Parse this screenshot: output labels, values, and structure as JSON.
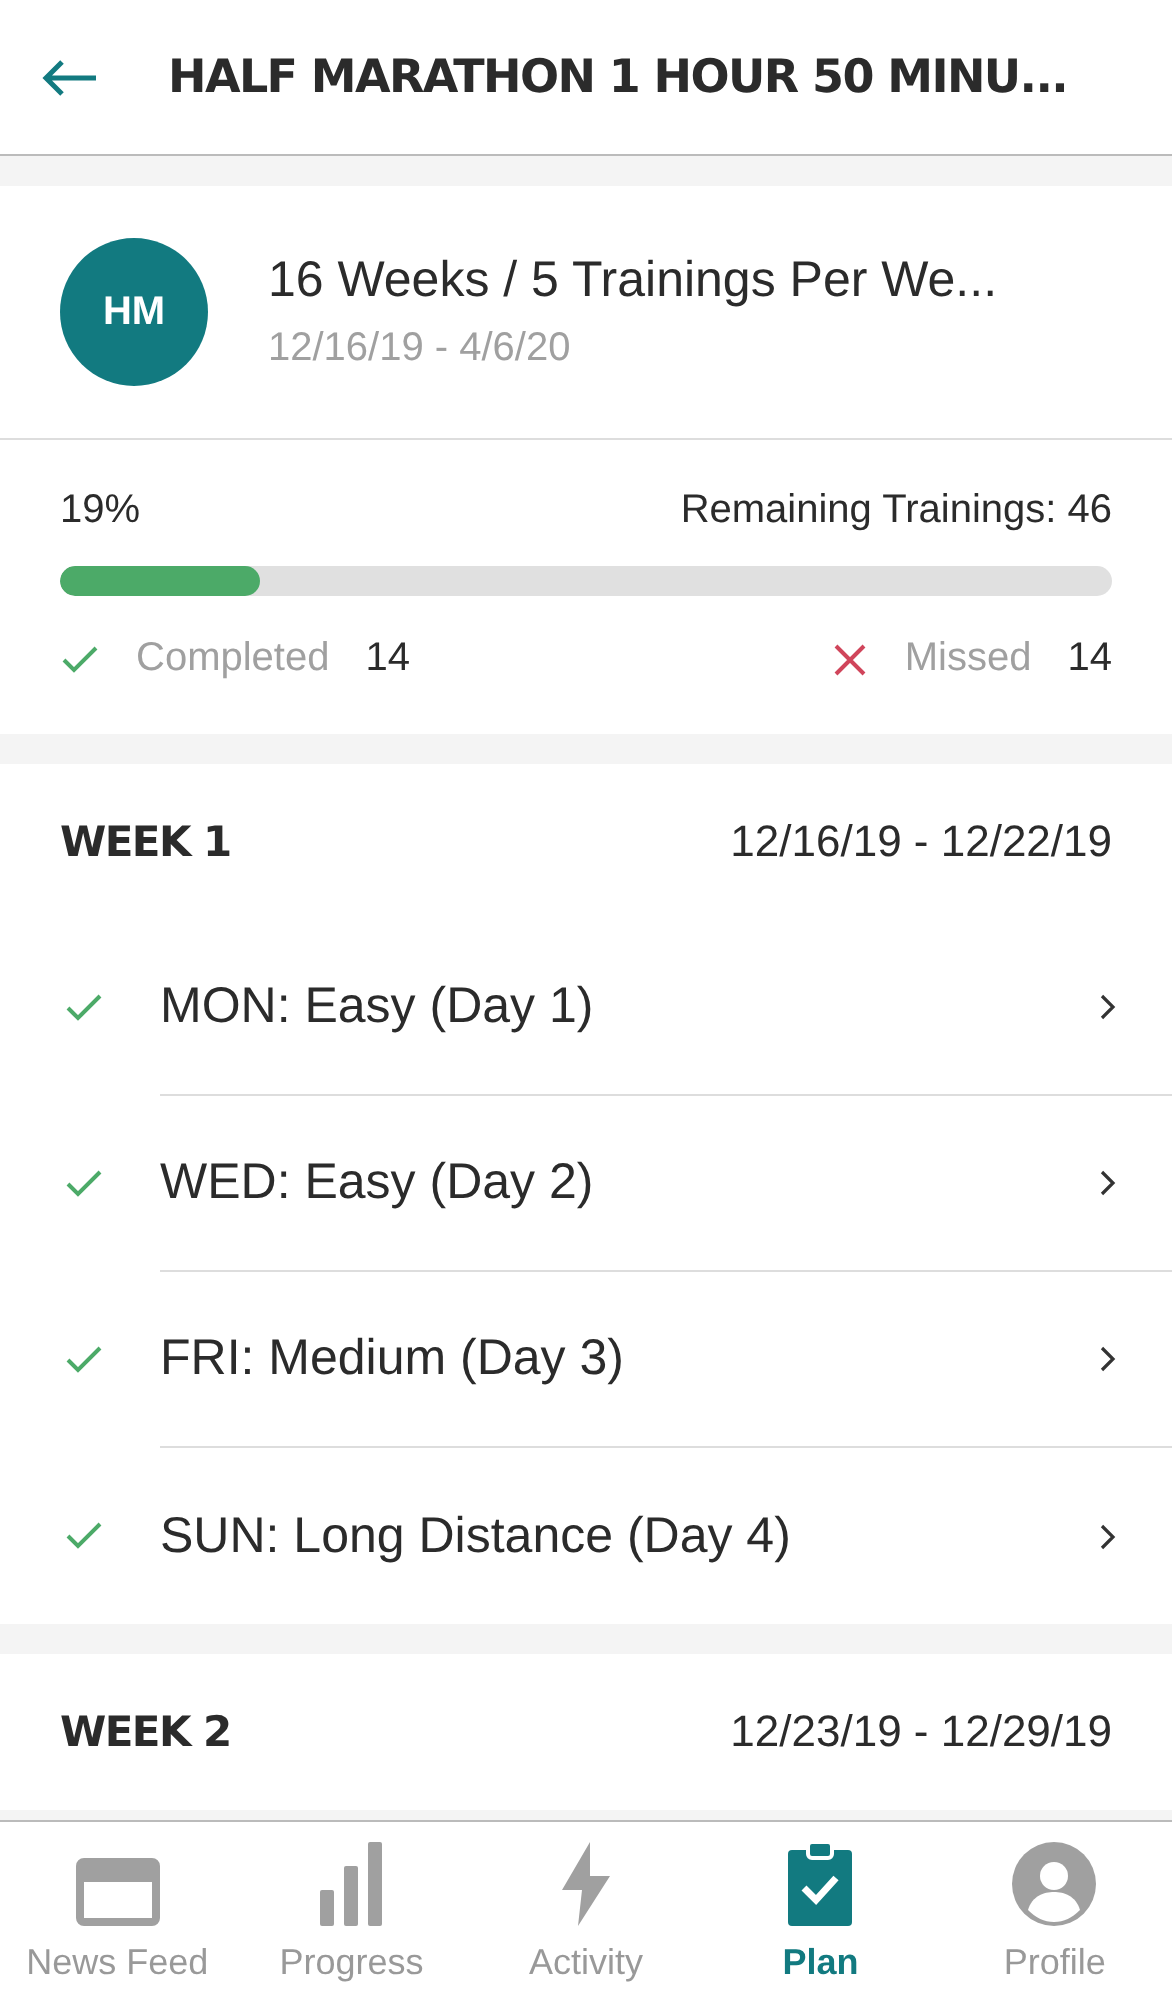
{
  "header": {
    "title": "HALF MARATHON 1 HOUR 50 MINU..."
  },
  "plan": {
    "initials": "HM",
    "name": "16 Weeks / 5 Trainings Per We...",
    "dates": "12/16/19 - 4/6/20"
  },
  "progress": {
    "percent": "19%",
    "remaining": "Remaining Trainings: 46",
    "level": 0.19,
    "completed_label": "Completed",
    "completed": "14",
    "missed_label": "Missed",
    "missed": "14"
  },
  "weeks": [
    {
      "title": "WEEK 1",
      "dates": "12/16/19 - 12/22/19",
      "trainings": [
        {
          "label": "MON: Easy (Day 1)",
          "done": true
        },
        {
          "label": "WED: Easy (Day 2)",
          "done": true
        },
        {
          "label": "FRI: Medium (Day 3)",
          "done": true
        },
        {
          "label": "SUN: Long Distance (Day 4)",
          "done": true
        }
      ]
    },
    {
      "title": "WEEK 2",
      "dates": "12/23/19 - 12/29/19"
    }
  ],
  "tabs": [
    {
      "kind": "feed",
      "label": "News Feed",
      "selected": false
    },
    {
      "kind": "progress",
      "label": "Progress",
      "selected": false
    },
    {
      "kind": "activity",
      "label": "Activity",
      "selected": false
    },
    {
      "kind": "plan",
      "label": "Plan",
      "selected": true
    },
    {
      "kind": "profile",
      "label": "Profile",
      "selected": false
    }
  ]
}
